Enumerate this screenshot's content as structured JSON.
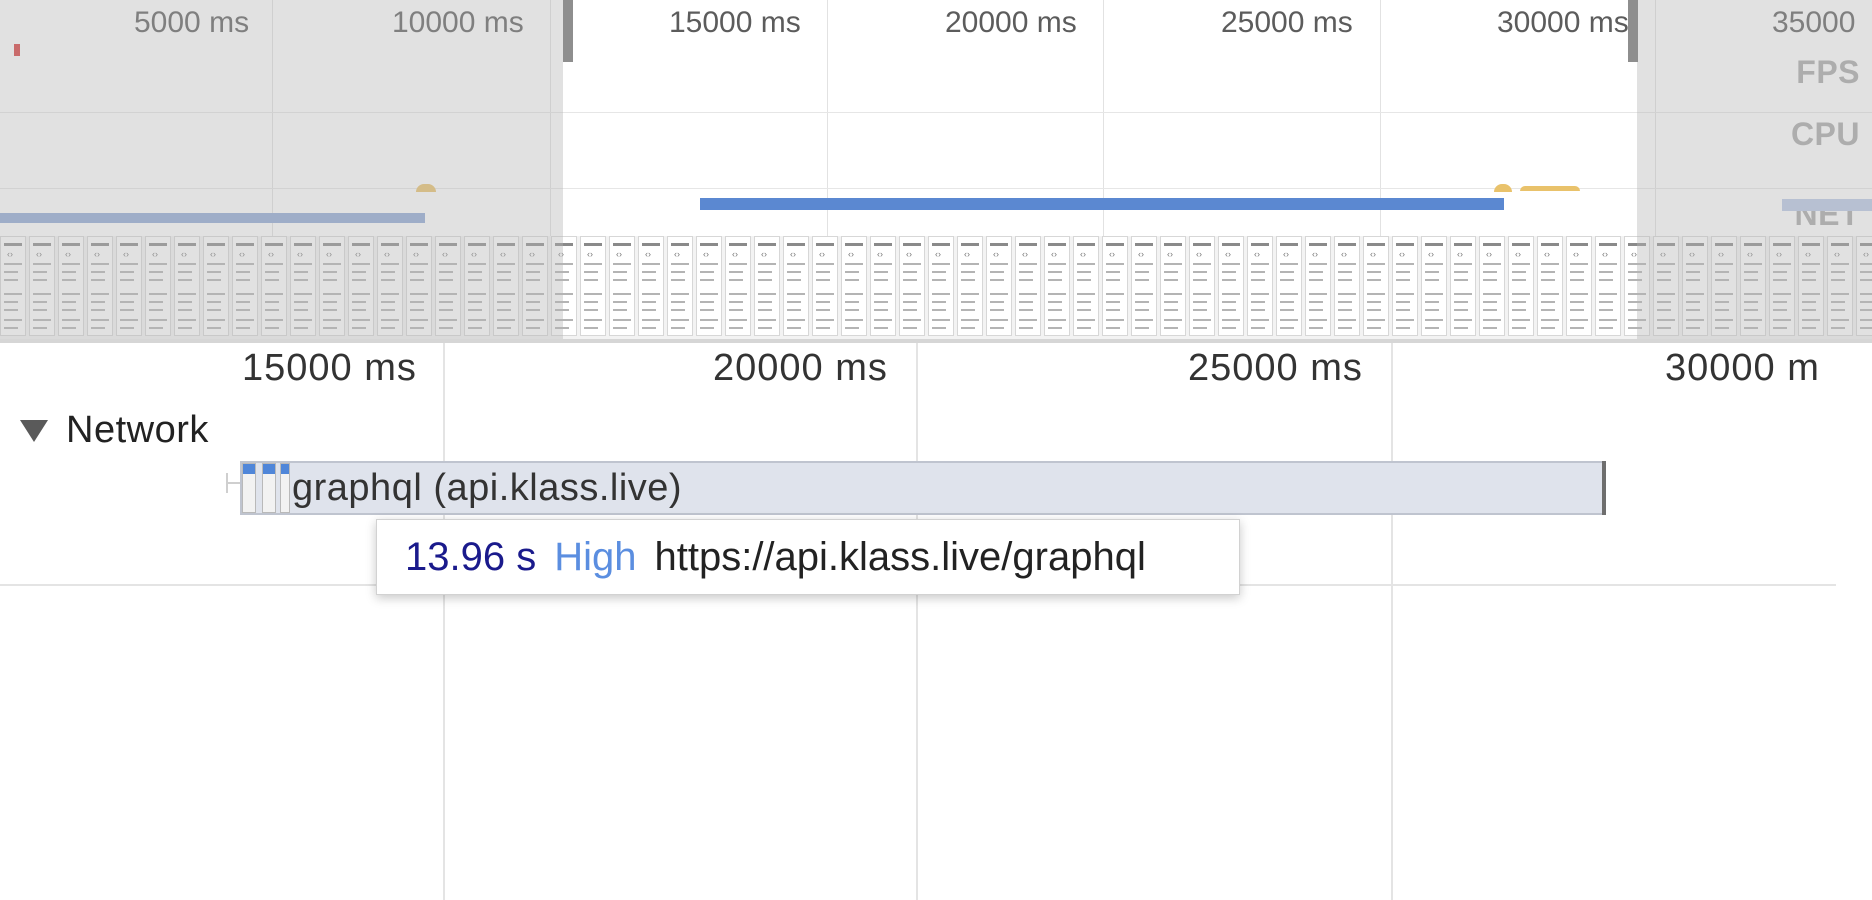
{
  "overview": {
    "ruler": [
      "5000 ms",
      "10000 ms",
      "15000 ms",
      "20000 ms",
      "25000 ms",
      "30000 ms",
      "35000"
    ],
    "tracks": {
      "fps": "FPS",
      "cpu": "CPU",
      "net": "NET"
    },
    "fps_color": "#d83b3b",
    "net_bar_color": "#5b88d1",
    "cpu_color": "#e9c26b"
  },
  "main": {
    "ruler": [
      "15000 ms",
      "20000 ms",
      "25000 ms",
      "30000 m"
    ],
    "network": {
      "title": "Network",
      "request": {
        "label": "graphql (api.klass.live)",
        "bar_color": "#dfe3ec"
      }
    },
    "tooltip": {
      "duration": "13.96 s",
      "priority": "High",
      "url": "https://api.klass.live/graphql",
      "duration_color": "#1a1a8c",
      "priority_color": "#5b8ee0"
    }
  }
}
